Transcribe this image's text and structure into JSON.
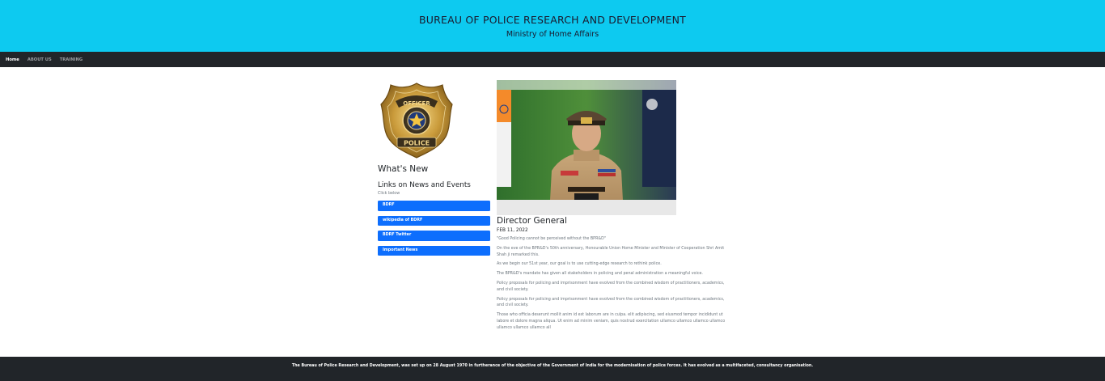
{
  "header": {
    "title": "BUREAU OF POLICE RESEARCH AND DEVELOPMENT",
    "subtitle": "Ministry of Home Affairs"
  },
  "nav": {
    "items": [
      {
        "label": "Home"
      },
      {
        "label": "ABOUT US"
      },
      {
        "label": "TRAINING"
      }
    ]
  },
  "sidebar": {
    "whats_new": "What's New",
    "links_title": "Links on News and Events",
    "click_below": "Click below",
    "buttons": [
      {
        "label": "BDRF"
      },
      {
        "label": "wikipedia of BDRF"
      },
      {
        "label": "BDRF Twitter"
      },
      {
        "label": "Important News"
      }
    ]
  },
  "article": {
    "title": "Director General",
    "date": "FEB 11, 2022",
    "paragraphs": [
      "\"Good Policing cannot be perceived without the BPR&D\"",
      "On the eve of the BPR&D's 50th anniversary, Honourable Union Home Minister and Minister of Cooperation Shri Amit Shah ji remarked this.",
      "As we begin our 51st year, our goal is to use cutting-edge research to rethink police.",
      "The BPR&D's mandate has given all stakeholders in policing and penal administration a meaningful voice.",
      "Policy proposals for policing and imprisonment have evolved from the combined wisdom of practitioners, academics, and civil society.",
      "Policy proposals for policing and imprisonment have evolved from the combined wisdom of practitioners, academics, and civil society.",
      "Those who officia deserunt mollit anim id est laborum are in culpa. elit adipiscing, sed eiusmod tempor incididunt ut labore et dolore magna aliqua. Ut enim ad minim veniam, quis nostrud exercitation ullamco ullamco ullamco ullamco ullamco ullamco ullamco all"
    ]
  },
  "footer": {
    "text": "The Bureau of Police Research and Development, was set up on 28 August 1970 in furtherance of the objective of the Government of India for the modernisation of police forces. It has evolved as a multifaceted, consultancy organisation."
  },
  "images": {
    "badge_text_top": "OFFICER",
    "badge_text_bottom": "POLICE"
  },
  "colors": {
    "header_bg": "#0dcaf0",
    "navbar_bg": "#212529",
    "button_bg": "#0d6efd",
    "footer_bg": "#212529"
  }
}
